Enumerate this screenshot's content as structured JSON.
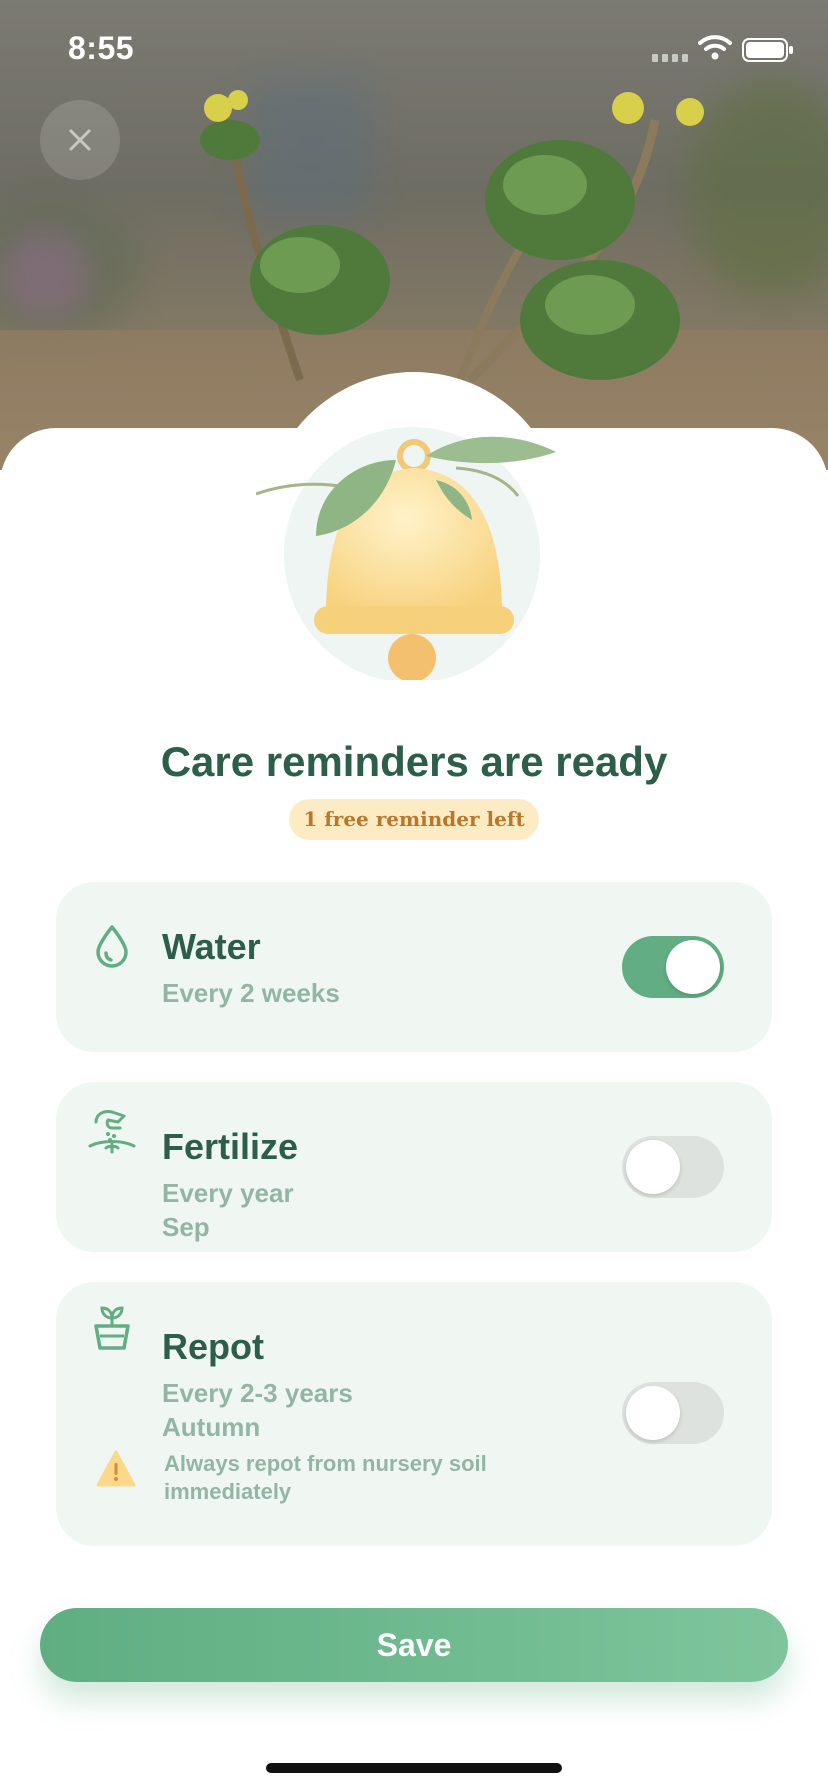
{
  "status_bar": {
    "time": "8:55"
  },
  "header": {
    "close_icon": "close-icon"
  },
  "hero": {
    "illustration": "bell-with-leaves"
  },
  "title": "Care reminders are ready",
  "badge": "1 free reminder left",
  "reminders": [
    {
      "name": "Water",
      "icon": "water-drop-icon",
      "lines": [
        "Every 2 weeks"
      ],
      "enabled": true
    },
    {
      "name": "Fertilize",
      "icon": "fertilize-icon",
      "lines": [
        "Every year",
        "Sep"
      ],
      "enabled": false
    },
    {
      "name": "Repot",
      "icon": "pot-icon",
      "lines": [
        "Every 2-3 years",
        "Autumn"
      ],
      "enabled": false,
      "warning": "Always repot from nursery soil immediately"
    }
  ],
  "save_label": "Save",
  "colors": {
    "accent": "#62ad84",
    "title": "#2c5e4a",
    "card_bg": "#f0f7f3",
    "badge_bg": "#fdebc3",
    "badge_text": "#b9772b"
  }
}
